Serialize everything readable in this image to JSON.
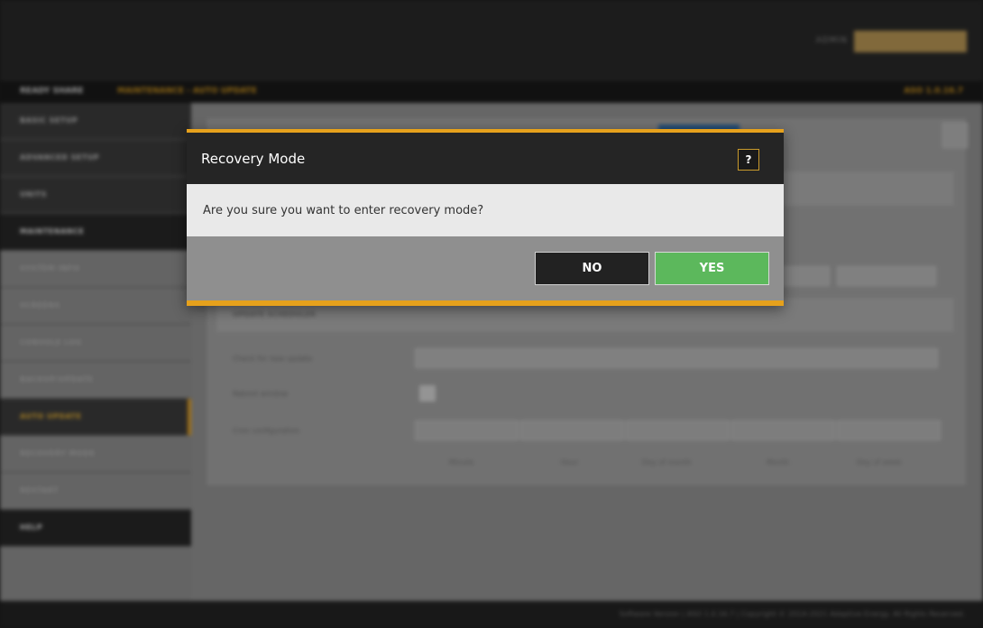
{
  "background": {
    "user_label": "ADMIN",
    "breadcrumb_home": "READY SHARE",
    "breadcrumb_path": "MAINTENANCE - AUTO UPDATE",
    "firmware": "ASO 1.0.16.7",
    "sidebar": [
      {
        "label": "BASIC SETUP",
        "style": "dark"
      },
      {
        "label": "ADVANCED SETUP",
        "style": "dark"
      },
      {
        "label": "UNITS",
        "style": "dark"
      },
      {
        "label": "MAINTENANCE",
        "style": "darkest"
      },
      {
        "label": "SYSTEM INFO",
        "style": "light"
      },
      {
        "label": "SCREENS",
        "style": "light"
      },
      {
        "label": "CONSOLE LOG",
        "style": "light"
      },
      {
        "label": "BACKUP/UPDATE",
        "style": "light"
      },
      {
        "label": "AUTO UPDATE",
        "style": "active"
      },
      {
        "label": "RECOVERY MODE",
        "style": "light"
      },
      {
        "label": "RESTART",
        "style": "light"
      },
      {
        "label": "HELP",
        "style": "darkest"
      }
    ],
    "section_title": "UPDATE SCHEDULER",
    "rows": {
      "check": "Check for new update",
      "reboot": "Reboot window",
      "cron": "Cron configuration"
    },
    "cron_labels": [
      "Minute",
      "Hour",
      "Day of month",
      "Month",
      "Day of week"
    ],
    "footer_text": "Software Version | ASO 1.0.16.7 | Copyright © 2014-2021 Adaptive Energy. All Rights Reserved."
  },
  "modal": {
    "title": "Recovery Mode",
    "help_label": "?",
    "message": "Are you sure you want to enter recovery mode?",
    "no_label": "NO",
    "yes_label": "YES",
    "accent_color": "#e6a11c",
    "yes_color": "#5cb85c"
  }
}
